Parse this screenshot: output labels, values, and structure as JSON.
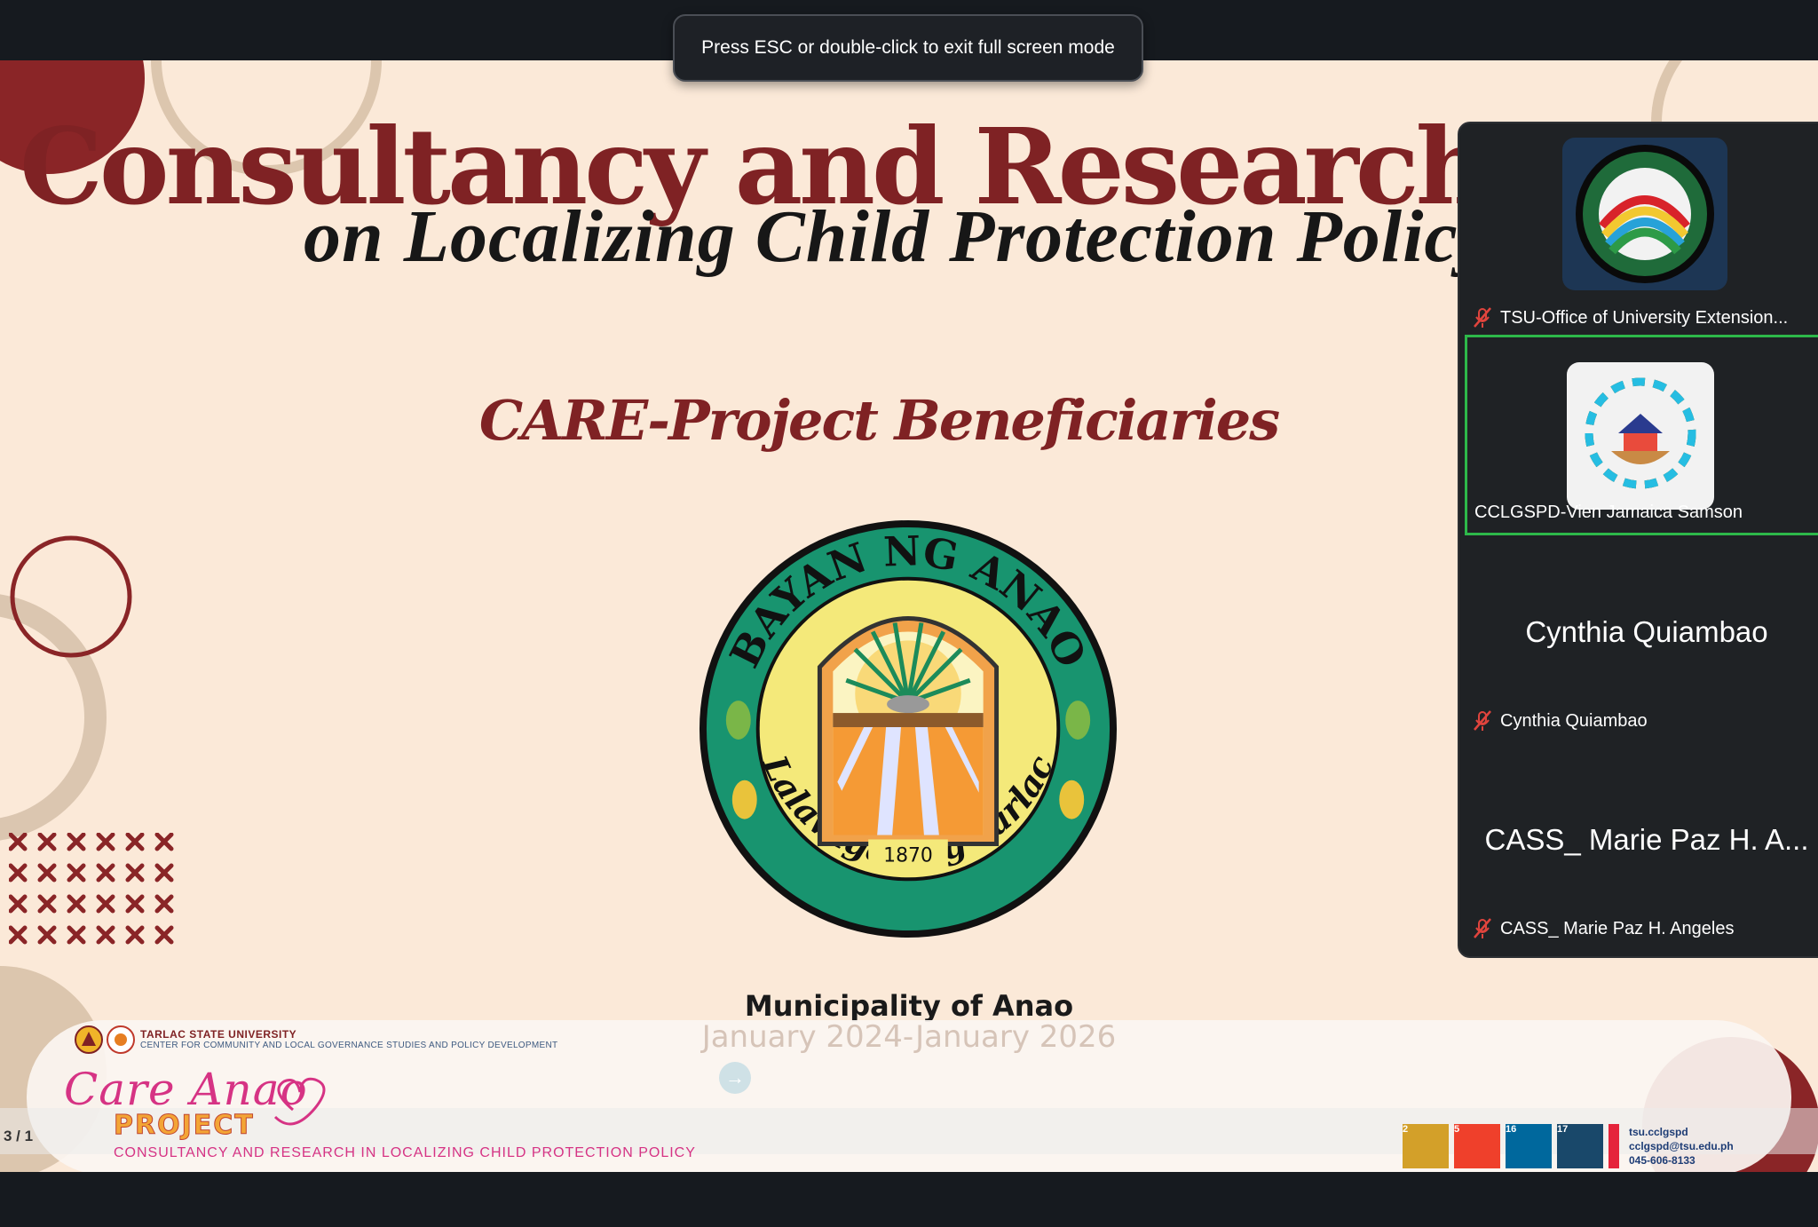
{
  "browser": {
    "fullscreen_notice": "Press ESC or double-click to exit full screen mode"
  },
  "slide": {
    "title": "Consultancy and Research (CARE",
    "subtitle": "on Localizing Child Protection Policy",
    "section_title": "CARE-Project Beneficiaries",
    "seal": {
      "top_text": "BAYAN NG ANAO",
      "bottom_text": "Lalawigan ng Tarlac",
      "year": "1870"
    },
    "municipality": "Municipality of Anao",
    "period": "January 2024-January 2026",
    "counter": "3 / 1"
  },
  "banner": {
    "university": "TARLAC STATE UNIVERSITY",
    "center": "CENTER FOR COMMUNITY AND LOCAL GOVERNANCE STUDIES AND POLICY DEVELOPMENT",
    "script_title": "Care Anao",
    "project_word": "PROJECT",
    "tagline": "CONSULTANCY AND RESEARCH IN LOCALIZING CHILD PROTECTION POLICY",
    "sdgs": [
      {
        "number": "2",
        "color": "#d3a029"
      },
      {
        "number": "5",
        "color": "#ef402b"
      },
      {
        "number": "16",
        "color": "#00689d"
      },
      {
        "number": "17",
        "color": "#19486a"
      }
    ],
    "contact": {
      "facebook": "tsu.cclgspd",
      "email": "cclgspd@tsu.edu.ph",
      "phone": "045-606-8133"
    }
  },
  "participants": [
    {
      "label": "TSU-Office of University Extension...",
      "muted": true,
      "kind": "tsu-logo"
    },
    {
      "label": "CCLGSPD-Vien Jamaica Samson",
      "muted": false,
      "kind": "cclgspd-logo",
      "active": true
    },
    {
      "big_name": "Cynthia Quiambao",
      "label": "Cynthia Quiambao",
      "muted": true
    },
    {
      "big_name": "CASS_  Marie Paz H. A...",
      "label": "CASS_  Marie Paz H. Angeles",
      "muted": true
    }
  ],
  "colors": {
    "slide_bg": "#fbe9d8",
    "title_maroon": "#7f2224",
    "active_border": "#2db84a",
    "panel_bg": "#1f2225"
  }
}
